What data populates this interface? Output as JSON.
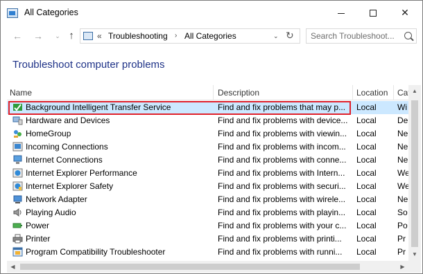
{
  "window": {
    "title": "All Categories"
  },
  "window_controls": {
    "minimize": "minimize",
    "maximize": "maximize",
    "close": "✕"
  },
  "nav": {
    "back": "←",
    "forward": "→",
    "recent": "⌄",
    "up": "↑"
  },
  "address": {
    "separator_start": "«",
    "crumbs": [
      "Troubleshooting",
      "All Categories"
    ],
    "separator": "›",
    "dropdown": "⌄",
    "refresh": "↻"
  },
  "search": {
    "placeholder": "Search Troubleshoot..."
  },
  "heading": "Troubleshoot computer problems",
  "table": {
    "columns": [
      "Name",
      "Description",
      "Location",
      "Cat"
    ],
    "rows": [
      {
        "icon": "bits-icon",
        "name": "Background Intelligent Transfer Service",
        "description": "Find and fix problems that may p...",
        "location": "Local",
        "category": "Wi",
        "selected": true
      },
      {
        "icon": "hardware-icon",
        "name": "Hardware and Devices",
        "description": "Find and fix problems with device...",
        "location": "Local",
        "category": "De"
      },
      {
        "icon": "homegroup-icon",
        "name": "HomeGroup",
        "description": "Find and fix problems with viewin...",
        "location": "Local",
        "category": "Ne"
      },
      {
        "icon": "incoming-connections-icon",
        "name": "Incoming Connections",
        "description": "Find and fix problems with incom...",
        "location": "Local",
        "category": "Ne"
      },
      {
        "icon": "internet-connections-icon",
        "name": "Internet Connections",
        "description": "Find and fix problems with conne...",
        "location": "Local",
        "category": "Ne"
      },
      {
        "icon": "ie-performance-icon",
        "name": "Internet Explorer Performance",
        "description": "Find and fix problems with Intern...",
        "location": "Local",
        "category": "We"
      },
      {
        "icon": "ie-safety-icon",
        "name": "Internet Explorer Safety",
        "description": "Find and fix problems with securi...",
        "location": "Local",
        "category": "We"
      },
      {
        "icon": "network-adapter-icon",
        "name": "Network Adapter",
        "description": "Find and fix problems with wirele...",
        "location": "Local",
        "category": "Ne"
      },
      {
        "icon": "playing-audio-icon",
        "name": "Playing Audio",
        "description": "Find and fix problems with playin...",
        "location": "Local",
        "category": "So"
      },
      {
        "icon": "power-icon",
        "name": "Power",
        "description": "Find and fix problems with your c...",
        "location": "Local",
        "category": "Po"
      },
      {
        "icon": "printer-icon",
        "name": "Printer",
        "description": "Find and fix problems with printi...",
        "location": "Local",
        "category": "Pr"
      },
      {
        "icon": "program-compatibility-icon",
        "name": "Program Compatibility Troubleshooter",
        "description": "Find and fix problems with runni...",
        "location": "Local",
        "category": "Pr"
      }
    ]
  },
  "scrollbars": {
    "up": "▲",
    "down": "▼",
    "left": "◀",
    "right": "▶"
  },
  "colors": {
    "heading": "#1e3287",
    "selection": "#cce8ff",
    "highlight_outline": "#e0202a"
  }
}
